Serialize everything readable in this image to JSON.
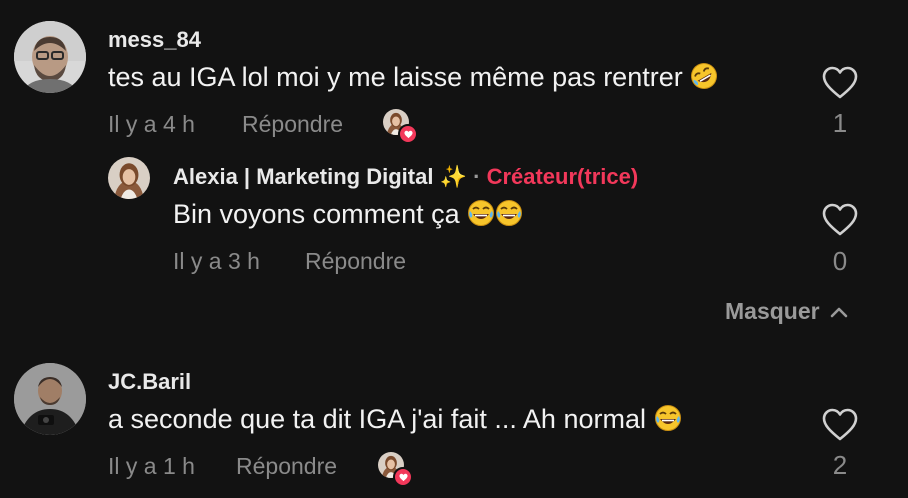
{
  "comments": [
    {
      "username": "mess_84",
      "text": "tes au IGA lol moi y me laisse même pas rentrer",
      "time": "Il y a 4 h",
      "reply_label": "Répondre",
      "like_count": "1"
    },
    {
      "username": "JC.Baril",
      "text": "a seconde que ta dit IGA j'ai fait ... Ah normal",
      "time": "Il y a 1 h",
      "reply_label": "Répondre",
      "like_count": "2"
    }
  ],
  "reply": {
    "username": "Alexia | Marketing Digital",
    "separator": "·",
    "creator_badge": "Créateur(trice)",
    "text": "Bin voyons comment ça",
    "time": "Il y a 3 h",
    "reply_label": "Répondre",
    "like_count": "0"
  },
  "hide_replies_label": "Masquer",
  "colors": {
    "background": "#121212",
    "creator_accent": "#f2385a",
    "muted_text": "#8a8a8a"
  },
  "icons": {
    "heart": "heart-outline-icon",
    "chevron": "chevron-up-icon",
    "emoji_rofl": "rolling-on-floor-laughing-emoji",
    "emoji_tears": "tears-of-joy-emoji",
    "sparkles": "sparkles-emoji"
  }
}
